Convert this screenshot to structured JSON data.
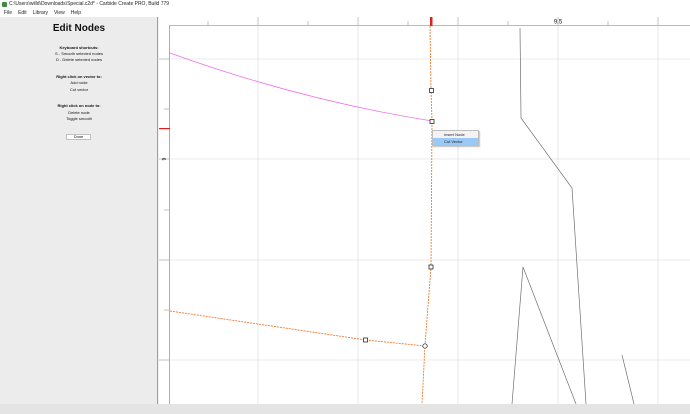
{
  "window": {
    "title": "C:\\Users\\willd\\Downloads\\Special.c2d* - Carbide Create PRO, Build 779"
  },
  "menu": [
    "File",
    "Edit",
    "Library",
    "View",
    "Help"
  ],
  "sidebar": {
    "title": "Edit Nodes",
    "keyboard_header": "Keyboard shortcuts:",
    "keyboard_items": [
      "S - Smooth selected nodes",
      "D - Delete selected nodes"
    ],
    "vector_header": "Right click on vector to:",
    "vector_items": [
      "Add node",
      "Cut vector"
    ],
    "node_header": "Right click on node to:",
    "node_items": [
      "Delete node",
      "Toggle smooth"
    ],
    "done_label": "Done"
  },
  "rulers": {
    "top_label": "9.5",
    "left_label": "6"
  },
  "context_menu": {
    "items": [
      "Insert Node",
      "Cut Vector"
    ],
    "highlighted": "Cut Vector"
  },
  "colors": {
    "selected_vector": "#f07a30",
    "magenta_vector": "#f06ee8",
    "grey_vector": "#707070",
    "ruler_marker": "#e02020",
    "menu_highlight": "#99c9f4"
  }
}
